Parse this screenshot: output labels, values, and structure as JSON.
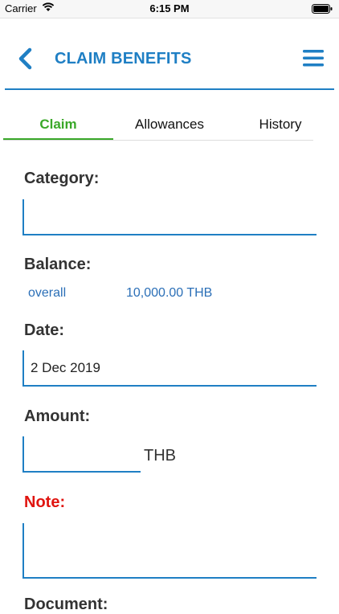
{
  "status_bar": {
    "carrier": "Carrier",
    "time": "6:15 PM"
  },
  "header": {
    "title": "CLAIM BENEFITS",
    "accent_color": "#1f7fc4"
  },
  "tabs": [
    {
      "label": "Claim",
      "active": true
    },
    {
      "label": "Allowances",
      "active": false
    },
    {
      "label": "History",
      "active": false
    }
  ],
  "form": {
    "category_label": "Category:",
    "category_value": "",
    "balance_label": "Balance:",
    "balance_key": "overall",
    "balance_value": "10,000.00 THB",
    "date_label": "Date:",
    "date_value": "2 Dec 2019",
    "amount_label": "Amount:",
    "amount_value": "",
    "amount_unit": "THB",
    "note_label": "Note:",
    "note_value": "",
    "next_label_partial": "Document:"
  },
  "colors": {
    "active_tab": "#3aa829",
    "note_label": "#e0140f",
    "link_text": "#2b6fb7"
  }
}
